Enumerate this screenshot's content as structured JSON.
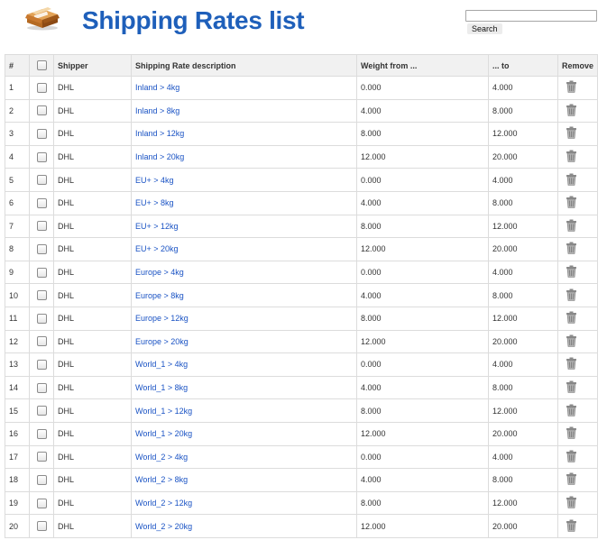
{
  "header": {
    "title": "Shipping Rates list",
    "search_value": "",
    "search_button": "Search"
  },
  "table": {
    "columns": [
      "#",
      "",
      "Shipper",
      "Shipping Rate description",
      "Weight from ...",
      "... to",
      "Remove"
    ],
    "rows": [
      {
        "num": "1",
        "shipper": "DHL",
        "desc": "Inland > 4kg",
        "from": "0.000",
        "to": "4.000"
      },
      {
        "num": "2",
        "shipper": "DHL",
        "desc": "Inland > 8kg",
        "from": "4.000",
        "to": "8.000"
      },
      {
        "num": "3",
        "shipper": "DHL",
        "desc": "Inland > 12kg",
        "from": "8.000",
        "to": "12.000"
      },
      {
        "num": "4",
        "shipper": "DHL",
        "desc": "Inland > 20kg",
        "from": "12.000",
        "to": "20.000"
      },
      {
        "num": "5",
        "shipper": "DHL",
        "desc": "EU+ > 4kg",
        "from": "0.000",
        "to": "4.000"
      },
      {
        "num": "6",
        "shipper": "DHL",
        "desc": "EU+ > 8kg",
        "from": "4.000",
        "to": "8.000"
      },
      {
        "num": "7",
        "shipper": "DHL",
        "desc": "EU+ > 12kg",
        "from": "8.000",
        "to": "12.000"
      },
      {
        "num": "8",
        "shipper": "DHL",
        "desc": "EU+ > 20kg",
        "from": "12.000",
        "to": "20.000"
      },
      {
        "num": "9",
        "shipper": "DHL",
        "desc": "Europe > 4kg",
        "from": "0.000",
        "to": "4.000"
      },
      {
        "num": "10",
        "shipper": "DHL",
        "desc": "Europe > 8kg",
        "from": "4.000",
        "to": "8.000"
      },
      {
        "num": "11",
        "shipper": "DHL",
        "desc": "Europe > 12kg",
        "from": "8.000",
        "to": "12.000"
      },
      {
        "num": "12",
        "shipper": "DHL",
        "desc": "Europe > 20kg",
        "from": "12.000",
        "to": "20.000"
      },
      {
        "num": "13",
        "shipper": "DHL",
        "desc": "World_1 > 4kg",
        "from": "0.000",
        "to": "4.000"
      },
      {
        "num": "14",
        "shipper": "DHL",
        "desc": "World_1 > 8kg",
        "from": "4.000",
        "to": "8.000"
      },
      {
        "num": "15",
        "shipper": "DHL",
        "desc": "World_1 > 12kg",
        "from": "8.000",
        "to": "12.000"
      },
      {
        "num": "16",
        "shipper": "DHL",
        "desc": "World_1 > 20kg",
        "from": "12.000",
        "to": "20.000"
      },
      {
        "num": "17",
        "shipper": "DHL",
        "desc": "World_2 > 4kg",
        "from": "0.000",
        "to": "4.000"
      },
      {
        "num": "18",
        "shipper": "DHL",
        "desc": "World_2 > 8kg",
        "from": "4.000",
        "to": "8.000"
      },
      {
        "num": "19",
        "shipper": "DHL",
        "desc": "World_2 > 12kg",
        "from": "8.000",
        "to": "12.000"
      },
      {
        "num": "20",
        "shipper": "DHL",
        "desc": "World_2 > 20kg",
        "from": "12.000",
        "to": "20.000"
      }
    ]
  },
  "icons": {
    "logo": "package-box-icon",
    "remove": "trash-can-icon"
  },
  "colors": {
    "title": "#1e5fba",
    "link": "#1a53c4",
    "header_bg": "#f1f1f1",
    "border": "#dcdcdc"
  }
}
